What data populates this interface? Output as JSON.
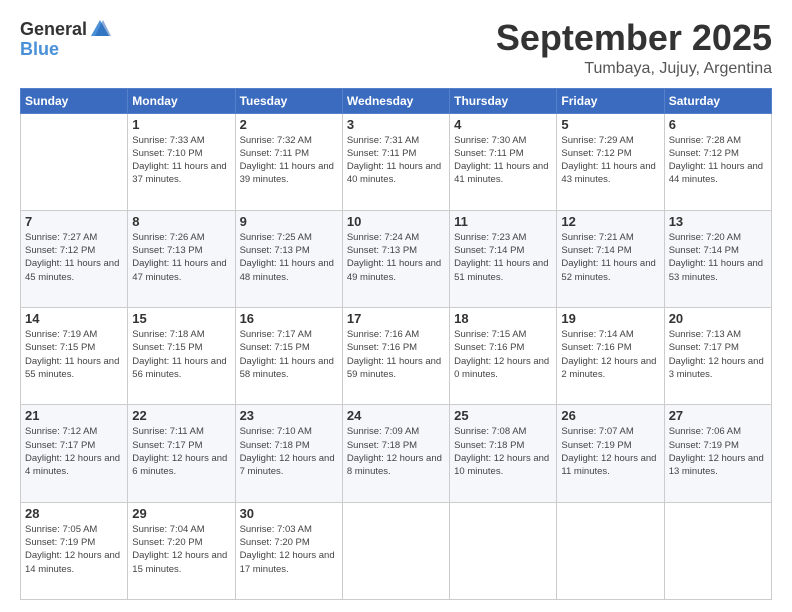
{
  "logo": {
    "general": "General",
    "blue": "Blue"
  },
  "title": "September 2025",
  "location": "Tumbaya, Jujuy, Argentina",
  "days_of_week": [
    "Sunday",
    "Monday",
    "Tuesday",
    "Wednesday",
    "Thursday",
    "Friday",
    "Saturday"
  ],
  "weeks": [
    [
      {
        "day": "",
        "sunrise": "",
        "sunset": "",
        "daylight": ""
      },
      {
        "day": "1",
        "sunrise": "Sunrise: 7:33 AM",
        "sunset": "Sunset: 7:10 PM",
        "daylight": "Daylight: 11 hours and 37 minutes."
      },
      {
        "day": "2",
        "sunrise": "Sunrise: 7:32 AM",
        "sunset": "Sunset: 7:11 PM",
        "daylight": "Daylight: 11 hours and 39 minutes."
      },
      {
        "day": "3",
        "sunrise": "Sunrise: 7:31 AM",
        "sunset": "Sunset: 7:11 PM",
        "daylight": "Daylight: 11 hours and 40 minutes."
      },
      {
        "day": "4",
        "sunrise": "Sunrise: 7:30 AM",
        "sunset": "Sunset: 7:11 PM",
        "daylight": "Daylight: 11 hours and 41 minutes."
      },
      {
        "day": "5",
        "sunrise": "Sunrise: 7:29 AM",
        "sunset": "Sunset: 7:12 PM",
        "daylight": "Daylight: 11 hours and 43 minutes."
      },
      {
        "day": "6",
        "sunrise": "Sunrise: 7:28 AM",
        "sunset": "Sunset: 7:12 PM",
        "daylight": "Daylight: 11 hours and 44 minutes."
      }
    ],
    [
      {
        "day": "7",
        "sunrise": "Sunrise: 7:27 AM",
        "sunset": "Sunset: 7:12 PM",
        "daylight": "Daylight: 11 hours and 45 minutes."
      },
      {
        "day": "8",
        "sunrise": "Sunrise: 7:26 AM",
        "sunset": "Sunset: 7:13 PM",
        "daylight": "Daylight: 11 hours and 47 minutes."
      },
      {
        "day": "9",
        "sunrise": "Sunrise: 7:25 AM",
        "sunset": "Sunset: 7:13 PM",
        "daylight": "Daylight: 11 hours and 48 minutes."
      },
      {
        "day": "10",
        "sunrise": "Sunrise: 7:24 AM",
        "sunset": "Sunset: 7:13 PM",
        "daylight": "Daylight: 11 hours and 49 minutes."
      },
      {
        "day": "11",
        "sunrise": "Sunrise: 7:23 AM",
        "sunset": "Sunset: 7:14 PM",
        "daylight": "Daylight: 11 hours and 51 minutes."
      },
      {
        "day": "12",
        "sunrise": "Sunrise: 7:21 AM",
        "sunset": "Sunset: 7:14 PM",
        "daylight": "Daylight: 11 hours and 52 minutes."
      },
      {
        "day": "13",
        "sunrise": "Sunrise: 7:20 AM",
        "sunset": "Sunset: 7:14 PM",
        "daylight": "Daylight: 11 hours and 53 minutes."
      }
    ],
    [
      {
        "day": "14",
        "sunrise": "Sunrise: 7:19 AM",
        "sunset": "Sunset: 7:15 PM",
        "daylight": "Daylight: 11 hours and 55 minutes."
      },
      {
        "day": "15",
        "sunrise": "Sunrise: 7:18 AM",
        "sunset": "Sunset: 7:15 PM",
        "daylight": "Daylight: 11 hours and 56 minutes."
      },
      {
        "day": "16",
        "sunrise": "Sunrise: 7:17 AM",
        "sunset": "Sunset: 7:15 PM",
        "daylight": "Daylight: 11 hours and 58 minutes."
      },
      {
        "day": "17",
        "sunrise": "Sunrise: 7:16 AM",
        "sunset": "Sunset: 7:16 PM",
        "daylight": "Daylight: 11 hours and 59 minutes."
      },
      {
        "day": "18",
        "sunrise": "Sunrise: 7:15 AM",
        "sunset": "Sunset: 7:16 PM",
        "daylight": "Daylight: 12 hours and 0 minutes."
      },
      {
        "day": "19",
        "sunrise": "Sunrise: 7:14 AM",
        "sunset": "Sunset: 7:16 PM",
        "daylight": "Daylight: 12 hours and 2 minutes."
      },
      {
        "day": "20",
        "sunrise": "Sunrise: 7:13 AM",
        "sunset": "Sunset: 7:17 PM",
        "daylight": "Daylight: 12 hours and 3 minutes."
      }
    ],
    [
      {
        "day": "21",
        "sunrise": "Sunrise: 7:12 AM",
        "sunset": "Sunset: 7:17 PM",
        "daylight": "Daylight: 12 hours and 4 minutes."
      },
      {
        "day": "22",
        "sunrise": "Sunrise: 7:11 AM",
        "sunset": "Sunset: 7:17 PM",
        "daylight": "Daylight: 12 hours and 6 minutes."
      },
      {
        "day": "23",
        "sunrise": "Sunrise: 7:10 AM",
        "sunset": "Sunset: 7:18 PM",
        "daylight": "Daylight: 12 hours and 7 minutes."
      },
      {
        "day": "24",
        "sunrise": "Sunrise: 7:09 AM",
        "sunset": "Sunset: 7:18 PM",
        "daylight": "Daylight: 12 hours and 8 minutes."
      },
      {
        "day": "25",
        "sunrise": "Sunrise: 7:08 AM",
        "sunset": "Sunset: 7:18 PM",
        "daylight": "Daylight: 12 hours and 10 minutes."
      },
      {
        "day": "26",
        "sunrise": "Sunrise: 7:07 AM",
        "sunset": "Sunset: 7:19 PM",
        "daylight": "Daylight: 12 hours and 11 minutes."
      },
      {
        "day": "27",
        "sunrise": "Sunrise: 7:06 AM",
        "sunset": "Sunset: 7:19 PM",
        "daylight": "Daylight: 12 hours and 13 minutes."
      }
    ],
    [
      {
        "day": "28",
        "sunrise": "Sunrise: 7:05 AM",
        "sunset": "Sunset: 7:19 PM",
        "daylight": "Daylight: 12 hours and 14 minutes."
      },
      {
        "day": "29",
        "sunrise": "Sunrise: 7:04 AM",
        "sunset": "Sunset: 7:20 PM",
        "daylight": "Daylight: 12 hours and 15 minutes."
      },
      {
        "day": "30",
        "sunrise": "Sunrise: 7:03 AM",
        "sunset": "Sunset: 7:20 PM",
        "daylight": "Daylight: 12 hours and 17 minutes."
      },
      {
        "day": "",
        "sunrise": "",
        "sunset": "",
        "daylight": ""
      },
      {
        "day": "",
        "sunrise": "",
        "sunset": "",
        "daylight": ""
      },
      {
        "day": "",
        "sunrise": "",
        "sunset": "",
        "daylight": ""
      },
      {
        "day": "",
        "sunrise": "",
        "sunset": "",
        "daylight": ""
      }
    ]
  ]
}
